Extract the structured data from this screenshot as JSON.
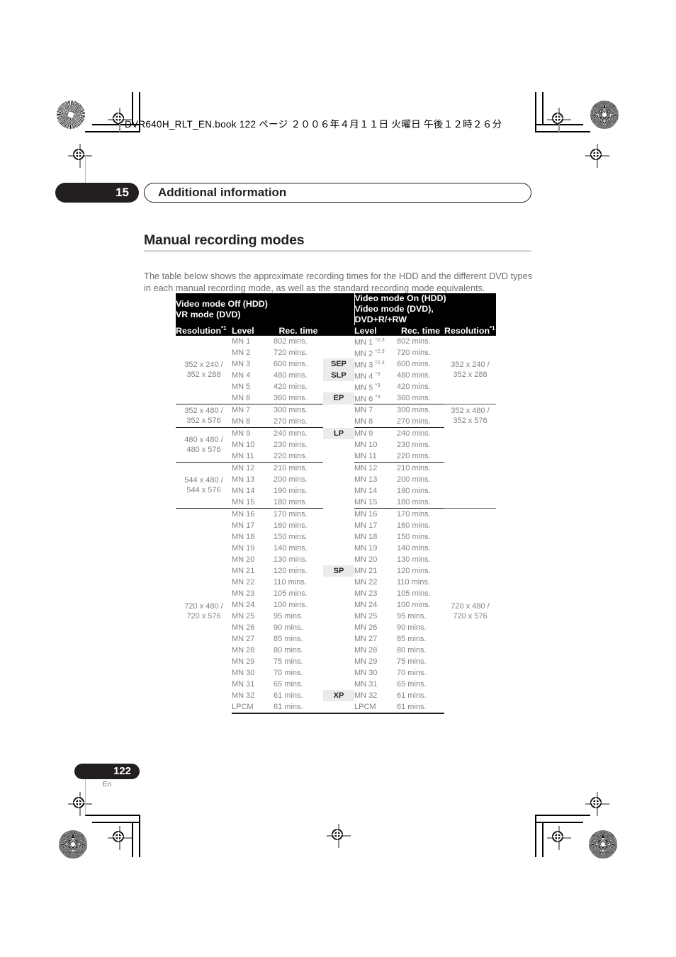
{
  "page": {
    "book_line": "DVR640H_RLT_EN.book   122 ページ   ２００６年４月１１日   火曜日   午後１２時２６分",
    "chapter_number": "15",
    "chapter_title": "Additional information",
    "section_title": "Manual recording modes",
    "intro": "The table below shows the approximate recording times for the HDD and the different DVD types in each manual recording mode, as well as the standard recording mode equivalents.",
    "page_number": "122",
    "language_code": "En"
  },
  "table": {
    "header": {
      "left_group": "Video mode Off (HDD)\nVR mode (DVD)",
      "left_group_line1": "Video mode Off (HDD)",
      "left_group_line2": "VR mode (DVD)",
      "right_group_line1": "Video mode On (HDD)",
      "right_group_line2": "Video mode (DVD),",
      "right_group_line3": "DVD+R/+RW",
      "col_resolution_left": "Resolution",
      "col_resolution_left_sup": "*1",
      "col_level_left": "Level",
      "col_rectime_left": "Rec. time",
      "col_mode": "",
      "col_level_right": "Level",
      "col_rectime_right": "Rec. time",
      "col_resolution_right": "Resolution",
      "col_resolution_right_sup": "*1"
    },
    "groups": [
      {
        "resolution_left_line1": "352 x 240 /",
        "resolution_left_line2": "352 x 288",
        "resolution_right_line1": "352 x 240 /",
        "resolution_right_line2": "352 x 288",
        "rows": [
          {
            "level_left": "MN 1",
            "time_left": "802 mins.",
            "mode": "",
            "level_right": "MN 1",
            "sup_right": "*2,3",
            "time_right": "802 mins."
          },
          {
            "level_left": "MN 2",
            "time_left": "720 mins.",
            "mode": "",
            "level_right": "MN 2",
            "sup_right": "*2,3",
            "time_right": "720 mins."
          },
          {
            "level_left": "MN 3",
            "time_left": "600 mins.",
            "mode": "SEP",
            "level_right": "MN 3",
            "sup_right": "*2,3",
            "time_right": "600 mins."
          },
          {
            "level_left": "MN 4",
            "time_left": "480 mins.",
            "mode": "SLP",
            "level_right": "MN 4",
            "sup_right": "*3",
            "time_right": "480 mins."
          },
          {
            "level_left": "MN 5",
            "time_left": "420 mins.",
            "mode": "",
            "level_right": "MN 5",
            "sup_right": "*3",
            "time_right": "420 mins."
          },
          {
            "level_left": "MN 6",
            "time_left": "360 mins.",
            "mode": "EP",
            "level_right": "MN 6",
            "sup_right": "*3",
            "time_right": "360 mins."
          }
        ]
      },
      {
        "resolution_left_line1": "352 x 480 /",
        "resolution_left_line2": "352 x 576",
        "resolution_right_line1": "352 x 480 /",
        "resolution_right_line2": "352 x 576",
        "rows": [
          {
            "level_left": "MN 7",
            "time_left": "300 mins.",
            "mode": "",
            "level_right": "MN 7",
            "sup_right": "",
            "time_right": "300 mins."
          },
          {
            "level_left": "MN 8",
            "time_left": "270 mins.",
            "mode": "",
            "level_right": "MN 8",
            "sup_right": "",
            "time_right": "270 mins."
          }
        ]
      },
      {
        "resolution_left_line1": "480 x 480 /",
        "resolution_left_line2": "480 x 576",
        "resolution_right_line1": "",
        "resolution_right_line2": "",
        "rows": [
          {
            "level_left": "MN 9",
            "time_left": "240 mins.",
            "mode": "LP",
            "level_right": "MN 9",
            "sup_right": "",
            "time_right": "240 mins."
          },
          {
            "level_left": "MN 10",
            "time_left": "230 mins.",
            "mode": "",
            "level_right": "MN 10",
            "sup_right": "",
            "time_right": "230 mins."
          },
          {
            "level_left": "MN 11",
            "time_left": "220 mins.",
            "mode": "",
            "level_right": "MN 11",
            "sup_right": "",
            "time_right": "220 mins."
          }
        ]
      },
      {
        "resolution_left_line1": "544 x 480 /",
        "resolution_left_line2": "544 x 576",
        "resolution_right_line1": "",
        "resolution_right_line2": "",
        "rows": [
          {
            "level_left": "MN 12",
            "time_left": "210 mins.",
            "mode": "",
            "level_right": "MN 12",
            "sup_right": "",
            "time_right": "210 mins."
          },
          {
            "level_left": "MN 13",
            "time_left": "200 mins.",
            "mode": "",
            "level_right": "MN 13",
            "sup_right": "",
            "time_right": "200 mins."
          },
          {
            "level_left": "MN 14",
            "time_left": "190 mins.",
            "mode": "",
            "level_right": "MN 14",
            "sup_right": "",
            "time_right": "190 mins."
          },
          {
            "level_left": "MN 15",
            "time_left": "180 mins.",
            "mode": "",
            "level_right": "MN 15",
            "sup_right": "",
            "time_right": "180 mins."
          }
        ]
      },
      {
        "resolution_left_line1": "720 x 480 /",
        "resolution_left_line2": "720 x 576",
        "resolution_right_line1": "720 x 480 /",
        "resolution_right_line2": "720 x 576",
        "rows": [
          {
            "level_left": "MN 16",
            "time_left": "170 mins.",
            "mode": "",
            "level_right": "MN 16",
            "sup_right": "",
            "time_right": "170 mins."
          },
          {
            "level_left": "MN 17",
            "time_left": "160 mins.",
            "mode": "",
            "level_right": "MN 17",
            "sup_right": "",
            "time_right": "160 mins."
          },
          {
            "level_left": "MN 18",
            "time_left": "150 mins.",
            "mode": "",
            "level_right": "MN 18",
            "sup_right": "",
            "time_right": "150 mins."
          },
          {
            "level_left": "MN 19",
            "time_left": "140 mins.",
            "mode": "",
            "level_right": "MN 19",
            "sup_right": "",
            "time_right": "140 mins."
          },
          {
            "level_left": "MN 20",
            "time_left": "130 mins.",
            "mode": "",
            "level_right": "MN 20",
            "sup_right": "",
            "time_right": "130 mins."
          },
          {
            "level_left": "MN 21",
            "time_left": "120 mins.",
            "mode": "SP",
            "level_right": "MN 21",
            "sup_right": "",
            "time_right": "120 mins."
          },
          {
            "level_left": "MN 22",
            "time_left": "110 mins.",
            "mode": "",
            "level_right": "MN 22",
            "sup_right": "",
            "time_right": "110 mins."
          },
          {
            "level_left": "MN 23",
            "time_left": "105 mins.",
            "mode": "",
            "level_right": "MN 23",
            "sup_right": "",
            "time_right": "105 mins."
          },
          {
            "level_left": "MN 24",
            "time_left": "100 mins.",
            "mode": "",
            "level_right": "MN 24",
            "sup_right": "",
            "time_right": "100 mins."
          },
          {
            "level_left": "MN 25",
            "time_left": "95 mins.",
            "mode": "",
            "level_right": "MN 25",
            "sup_right": "",
            "time_right": "95 mins."
          },
          {
            "level_left": "MN 26",
            "time_left": "90 mins.",
            "mode": "",
            "level_right": "MN 26",
            "sup_right": "",
            "time_right": "90 mins."
          },
          {
            "level_left": "MN 27",
            "time_left": "85 mins.",
            "mode": "",
            "level_right": "MN 27",
            "sup_right": "",
            "time_right": "85 mins."
          },
          {
            "level_left": "MN 28",
            "time_left": "80 mins.",
            "mode": "",
            "level_right": "MN 28",
            "sup_right": "",
            "time_right": "80 mins."
          },
          {
            "level_left": "MN 29",
            "time_left": "75 mins.",
            "mode": "",
            "level_right": "MN 29",
            "sup_right": "",
            "time_right": "75 mins."
          },
          {
            "level_left": "MN 30",
            "time_left": "70 mins.",
            "mode": "",
            "level_right": "MN 30",
            "sup_right": "",
            "time_right": "70 mins."
          },
          {
            "level_left": "MN 31",
            "time_left": "65 mins.",
            "mode": "",
            "level_right": "MN 31",
            "sup_right": "",
            "time_right": "65 mins."
          },
          {
            "level_left": "MN 32",
            "time_left": "61 mins.",
            "mode": "XP",
            "level_right": "MN 32",
            "sup_right": "",
            "time_right": "61 mins."
          },
          {
            "level_left": "LPCM",
            "time_left": "61 mins.",
            "mode": "",
            "level_right": "LPCM",
            "sup_right": "",
            "time_right": "61 mins."
          }
        ]
      }
    ]
  }
}
